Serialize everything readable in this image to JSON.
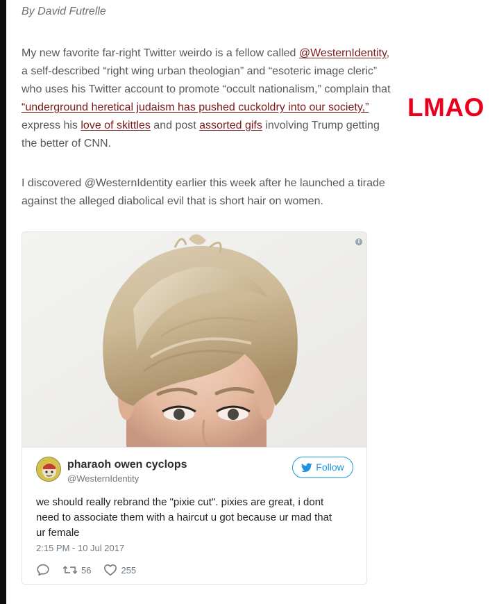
{
  "article": {
    "byline": "By David Futrelle",
    "paragraph1": {
      "line1_text": "My new favorite far-right Twitter weirdo is a fellow called ",
      "line1_link": "@WesternIdentity",
      "line1_after": ",",
      "line2": "a self-described “right wing urban theologian” and “esoteric image cleric”",
      "line3": "who uses his Twitter account to promote “occult nationalism,” complain that",
      "line4_link": "“underground heretical judaism has pushed cuckoldry into our society,”",
      "line5_before": "express his ",
      "line5_link1": "love of skittles",
      "line5_mid": " and post ",
      "line5_link2": "assorted gifs",
      "line5_after": " involving Trump getting",
      "line6": "the better of CNN."
    },
    "paragraph2": {
      "line1": "I discovered @WesternIdentity earlier this week after he launched a tirade",
      "line2": "against the alleged diabolical evil that is short hair on women."
    }
  },
  "annotation": {
    "text": "LMAO",
    "color": "#e8001c"
  },
  "tweet": {
    "user_name": "pharaoh owen cyclops",
    "user_handle": "@WesternIdentity",
    "follow_label": "Follow",
    "text_lines": [
      "we should really rebrand the \"pixie cut\". pixies are great, i dont",
      "need to associate them with a haircut u got because ur mad that",
      "ur female"
    ],
    "timestamp": "2:15 PM - 10 Jul 2017",
    "retweets": "56",
    "likes": "255",
    "info_icon": "i",
    "icons": {
      "info": "info-icon",
      "follow": "twitter-bird-icon",
      "reply": "reply-icon",
      "retweet": "retweet-icon",
      "like": "heart-icon"
    },
    "accent_color": "#1b95e0"
  },
  "colors": {
    "link": "#7a1a1a",
    "body_text": "#585858"
  }
}
